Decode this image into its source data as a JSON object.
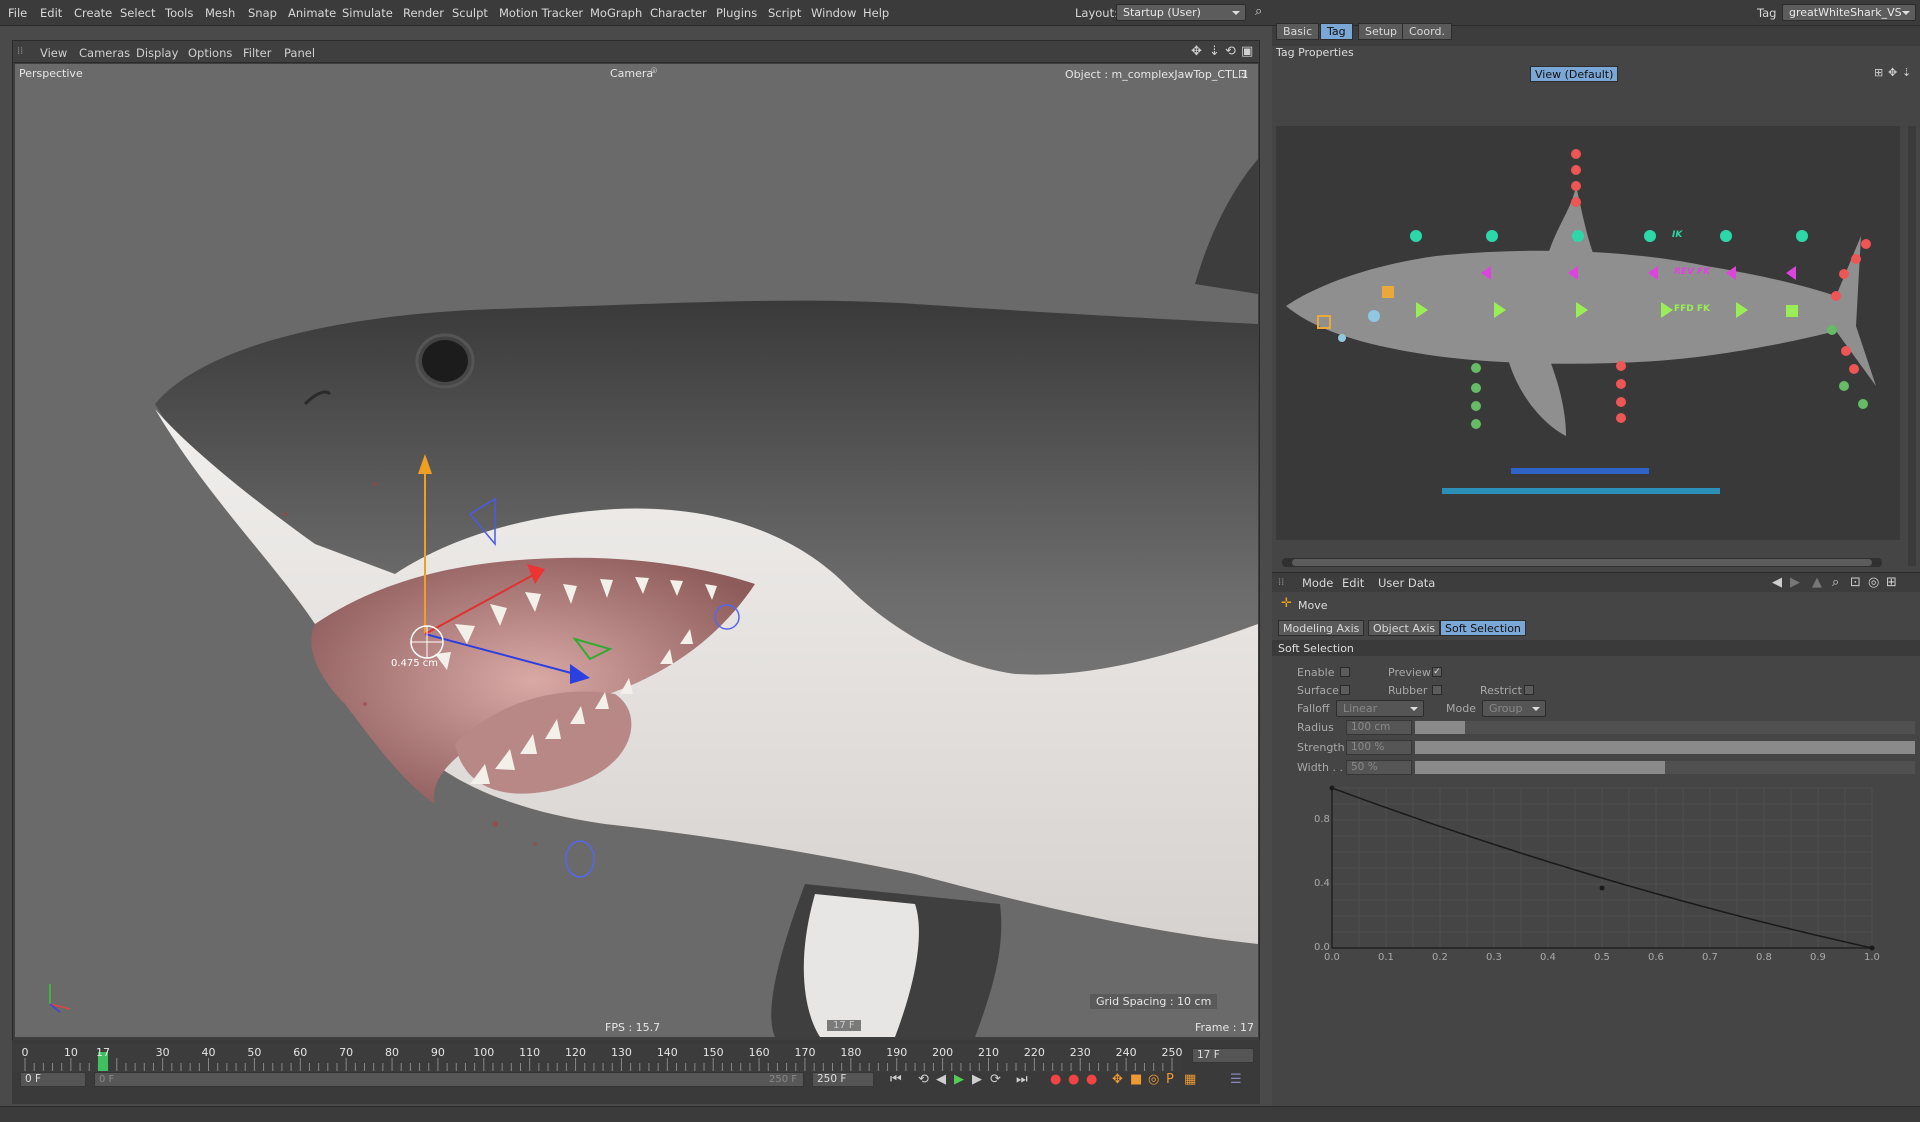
{
  "menubar": {
    "items": [
      "File",
      "Edit",
      "Create",
      "Select",
      "Tools",
      "Mesh",
      "Snap",
      "Animate",
      "Simulate",
      "Render",
      "Sculpt",
      "Motion Tracker",
      "MoGraph",
      "Character",
      "Plugins",
      "Script",
      "Window",
      "Help"
    ],
    "layout_label": "Layout:",
    "layout_value": "Startup (User)",
    "tag_label": "Tag",
    "tag_value": "greatWhiteShark_VS"
  },
  "viewport": {
    "menu": [
      "View",
      "Cameras",
      "Display",
      "Options",
      "Filter",
      "Panel"
    ],
    "view_name": "Perspective",
    "camera_label": "Camera",
    "object_label": "Object : m_complexJawTop_CTL.1",
    "measure": "0.475 cm",
    "grid_spacing": "Grid Spacing : 10 cm",
    "fps": "FPS : 15.7",
    "frame_badge": "17 F",
    "frame": "Frame : 17"
  },
  "timeline": {
    "ticks": [
      "0",
      "10",
      "17",
      "30",
      "40",
      "50",
      "60",
      "70",
      "80",
      "90",
      "100",
      "110",
      "120",
      "130",
      "140",
      "150",
      "160",
      "170",
      "180",
      "190",
      "200",
      "210",
      "220",
      "230",
      "240",
      "250"
    ],
    "current_frame_field": "17 F",
    "start_field": "0 F",
    "range_start": "0 F",
    "range_end": "250 F",
    "end_field": "250 F",
    "current_frame": 17,
    "max_frame": 250
  },
  "attr_top": {
    "tabs": [
      "Basic",
      "Tag",
      "Setup",
      "Coord."
    ],
    "active_tab": "Tag",
    "section_title": "Tag Properties",
    "view_button": "View (Default)",
    "rig_labels": {
      "ik": "IK",
      "rev_fk": "REV FK",
      "ffd_fk": "FFD FK"
    }
  },
  "attr_bottom": {
    "menu": [
      "Mode",
      "Edit",
      "User Data"
    ],
    "tool_name": "Move",
    "tabs": [
      "Modeling Axis",
      "Object Axis",
      "Soft Selection"
    ],
    "active_tab": "Soft Selection",
    "section_title": "Soft Selection",
    "enable_label": "Enable",
    "preview_label": "Preview",
    "preview_check": "✓",
    "surface_label": "Surface",
    "rubber_label": "Rubber",
    "restrict_label": "Restrict",
    "falloff_label": "Falloff",
    "falloff_value": "Linear",
    "mode_label": "Mode",
    "mode_value": "Group",
    "radius_label": "Radius",
    "radius_value": "100 cm",
    "radius_level": 0.1,
    "strength_label": "Strength",
    "strength_value": "100 %",
    "strength_level": 1.0,
    "width_label": "Width . .",
    "width_value": "50 %",
    "width_level": 0.5,
    "graph": {
      "y_ticks": [
        "0.8",
        "0.4",
        "0.0"
      ],
      "x_ticks": [
        "0.0",
        "0.1",
        "0.2",
        "0.3",
        "0.4",
        "0.5",
        "0.6",
        "0.7",
        "0.8",
        "0.9",
        "1.0"
      ]
    }
  }
}
